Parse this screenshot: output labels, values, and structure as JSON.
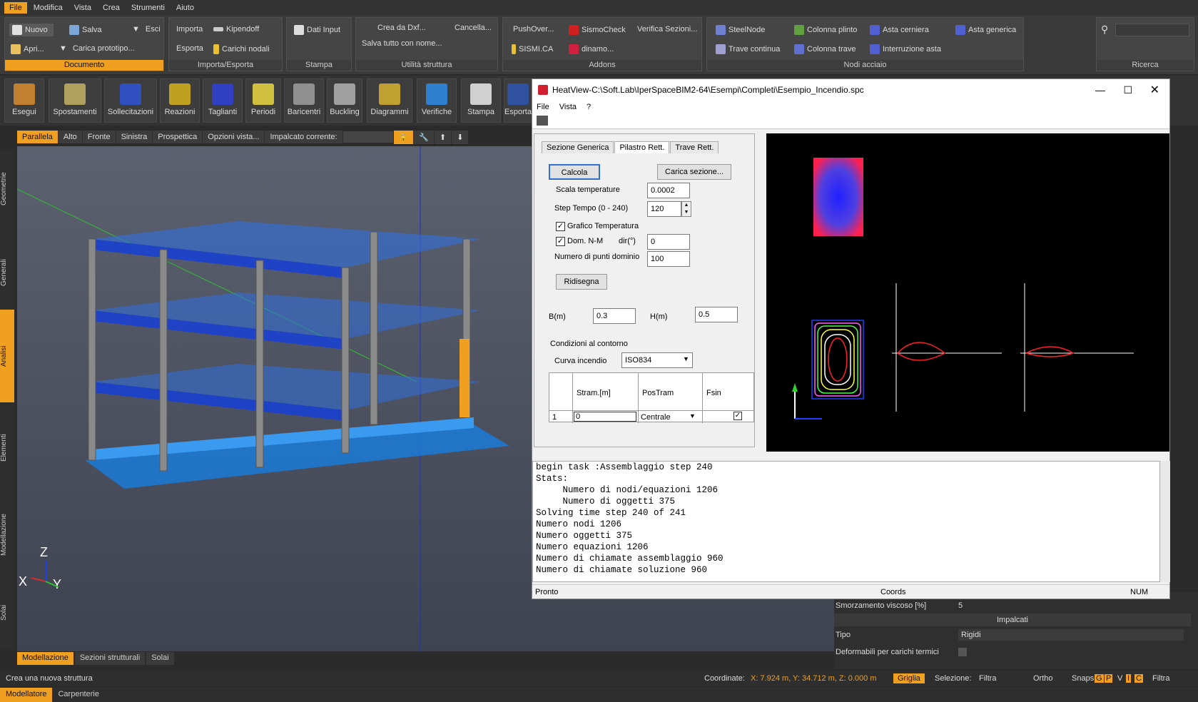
{
  "menu": [
    "File",
    "Modifica",
    "Vista",
    "Crea",
    "Strumenti",
    "Aiuto"
  ],
  "ribbon": {
    "documento": {
      "label": "Documento",
      "nuovo": "Nuovo",
      "salva": "Salva",
      "esci": "Esci",
      "apri": "Apri...",
      "carica": "Carica prototipo..."
    },
    "importa": {
      "label": "Importa/Esporta",
      "importa": "Importa",
      "kipendoff": "Kipendoff",
      "esporta": "Esporta",
      "carichi": "Carichi nodali"
    },
    "stampa": {
      "label": "Stampa",
      "dati": "Dati Input"
    },
    "utilita": {
      "label": "Utilità struttura",
      "crea": "Crea da Dxf...",
      "cancella": "Cancella...",
      "salvatutto": "Salva tutto con nome..."
    },
    "addons": {
      "label": "Addons",
      "push": "PushOver...",
      "sismo": "SismoCheck",
      "verifica": "Verifica Sezioni...",
      "sismi": "SISMI.CA",
      "dinamo": "dinamo..."
    },
    "nodi": {
      "label": "Nodi acciaio",
      "steel": "SteelNode",
      "plinto": "Colonna plinto",
      "cerniera": "Asta cerniera",
      "generica": "Asta generica",
      "trave": "Trave continua",
      "colonnatrave": "Colonna trave",
      "interruzione": "Interruzione asta"
    },
    "ricerca": "Ricerca"
  },
  "tools": [
    "Esegui",
    "Spostamenti",
    "Sollecitazioni",
    "Reazioni",
    "Taglianti",
    "Periodi",
    "Baricentri",
    "Buckling",
    "Diagrammi",
    "Verifiche",
    "Stampa",
    "Esporta"
  ],
  "viewtabs": [
    "Parallela",
    "Alto",
    "Fronte",
    "Sinistra",
    "Prospettica",
    "Opzioni vista...",
    "Impalcato corrente:"
  ],
  "lefttabs": [
    "Geometrie",
    "Generali",
    "Analisi",
    "Elementi",
    "Modellazione",
    "Solai"
  ],
  "bottomtabs": [
    "Modellazione",
    "Sezioni strutturali",
    "Solai"
  ],
  "status": {
    "left": "Crea una nuova struttura",
    "coords_label": "Coordinate:",
    "coords": "X: 7.924 m, Y: 34.712 m, Z: 0.000 m",
    "griglia": "Griglia",
    "selezione": "Selezione:",
    "filtra": "Filtra",
    "ortho": "Ortho",
    "snaps": "Snaps:",
    "snapkeys": [
      "G",
      "P",
      "V",
      "I",
      "C"
    ],
    "filtra2": "Filtra"
  },
  "modetabs": [
    "Modellatore",
    "Carpenterie"
  ],
  "rightpanel": {
    "smorzamento": "Smorzamento viscoso [%]",
    "smorz_val": "5",
    "impalcati": "Impalcati",
    "tipo": "Tipo",
    "tipo_val": "Rigidi",
    "deform": "Deformabili per carichi termici"
  },
  "axes": {
    "z": "Z",
    "x": "X",
    "y": "Y"
  },
  "heat": {
    "title": "HeatView-C:\\Soft.Lab\\IperSpaceBIM2-64\\Esempi\\Completi\\Esempio_Incendio.spc",
    "menu": [
      "File",
      "Vista",
      "?"
    ],
    "tabs": [
      "Sezione Generica",
      "Pilastro Rett.",
      "Trave Rett."
    ],
    "calcola": "Calcola",
    "carica": "Carica sezione...",
    "scala_lbl": "Scala temperature",
    "scala": "0.0002",
    "step_lbl": "Step Tempo (0 - 240)",
    "step": "120",
    "grafico": "Grafico Temperatura",
    "dom": "Dom. N-M",
    "dir": "dir(°)",
    "dir_val": "0",
    "npunti_lbl": "Numero di punti dominio",
    "npunti": "100",
    "ridisegna": "Ridisegna",
    "b_lbl": "B(m)",
    "b": "0.3",
    "h_lbl": "H(m)",
    "h": "0.5",
    "condizioni": "Condizioni al contorno",
    "curva_lbl": "Curva incendio",
    "curva": "ISO834",
    "cols": [
      "Stram.[m]",
      "PosTram",
      "Fsin"
    ],
    "row": {
      "n": "1",
      "stram": "0",
      "pos": "Centrale"
    },
    "console": [
      "begin task :Assemblaggio step 240",
      "Stats:",
      "     Numero di nodi/equazioni 1206",
      "     Numero di oggetti 375",
      "Solving time step 240 of 241",
      "Numero nodi 1206",
      "Numero oggetti 375",
      "Numero equazioni 1206",
      "Numero di chiamate assemblaggio 960",
      "Numero di chiamate soluzione 960"
    ],
    "status_left": "Pronto",
    "status_mid": "Coords",
    "status_right": "NUM"
  }
}
